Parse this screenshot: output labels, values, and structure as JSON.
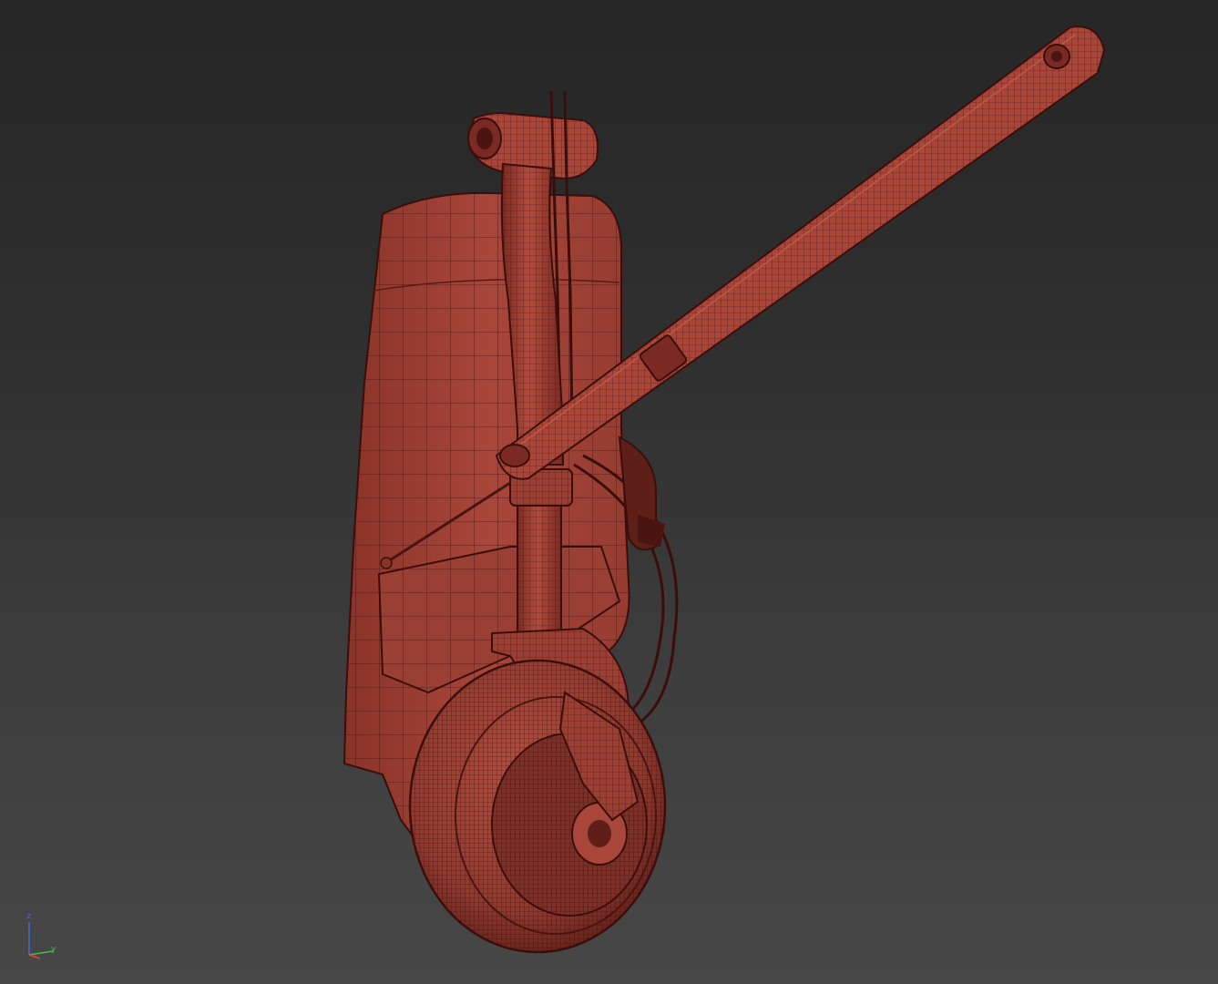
{
  "viewport": {
    "background_top": "#262626",
    "background_bottom": "#474747"
  },
  "model": {
    "surface_color": "#a8463a",
    "shade_color": "#7a2a22",
    "wire_color": "#4a1410",
    "dark_color": "#3a0e0b"
  },
  "gizmo": {
    "z_label": "z",
    "y_label": "y",
    "z_color": "#3f6fd8",
    "y_color": "#3fbf3f",
    "x_color": "#d84a3a"
  }
}
